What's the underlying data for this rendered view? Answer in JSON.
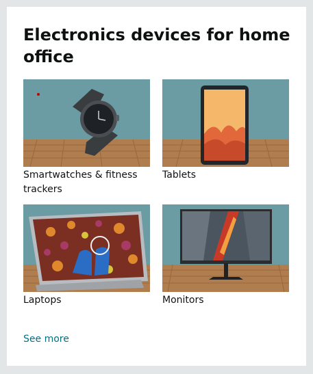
{
  "card": {
    "title": "Electronics devices for home office",
    "tiles": [
      {
        "label": "Smartwatches & fitness trackers",
        "icon": "smartwatch-image"
      },
      {
        "label": "Tablets",
        "icon": "tablet-image"
      },
      {
        "label": "Laptops",
        "icon": "laptop-image"
      },
      {
        "label": "Monitors",
        "icon": "monitor-image"
      }
    ],
    "see_more": "See more"
  },
  "colors": {
    "background": "#e3e6e6",
    "link": "#007185",
    "image_wall": "#6b9ba3",
    "floor": "#b07d4f"
  }
}
